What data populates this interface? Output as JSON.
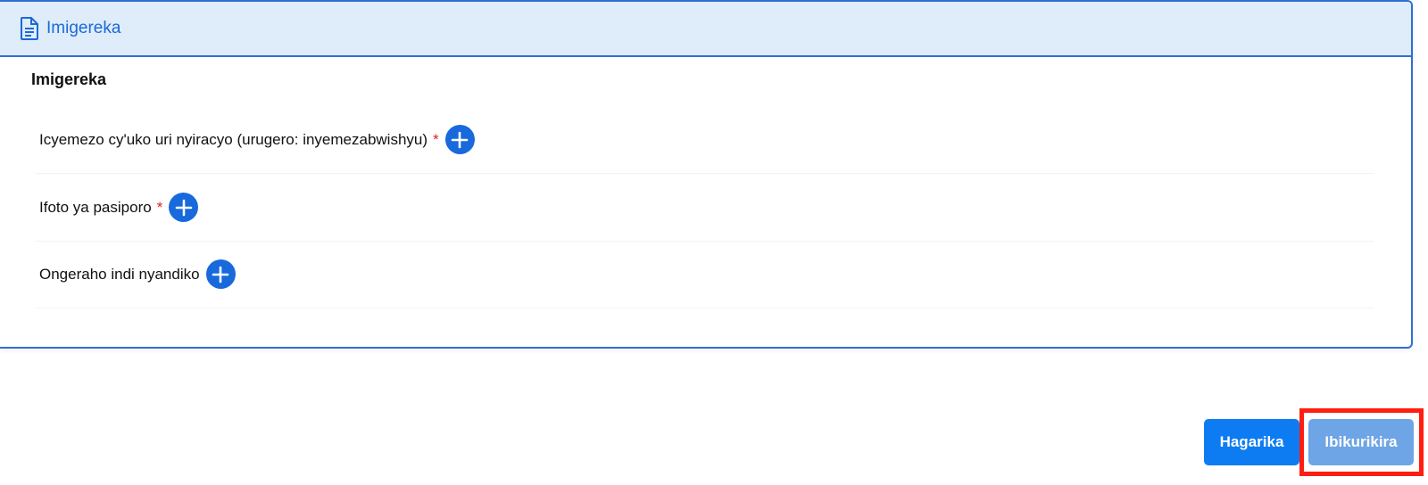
{
  "header": {
    "title": "Imigereka",
    "icon": "document-icon"
  },
  "section": {
    "title": "Imigereka"
  },
  "rows": [
    {
      "label": "Icyemezo cy'uko uri nyiracyo (urugero: inyemezabwishyu)",
      "required_mark": "*"
    },
    {
      "label": "Ifoto ya pasiporo",
      "required_mark": "*"
    },
    {
      "label": "Ongeraho indi nyandiko",
      "required_mark": ""
    }
  ],
  "actions": {
    "cancel_label": "Hagarika",
    "next_label": "Ibikurikira"
  },
  "colors": {
    "accent": "#1769dc",
    "header_bg": "#dfecf9",
    "required": "#e0202a",
    "highlight": "#ff1e10"
  }
}
